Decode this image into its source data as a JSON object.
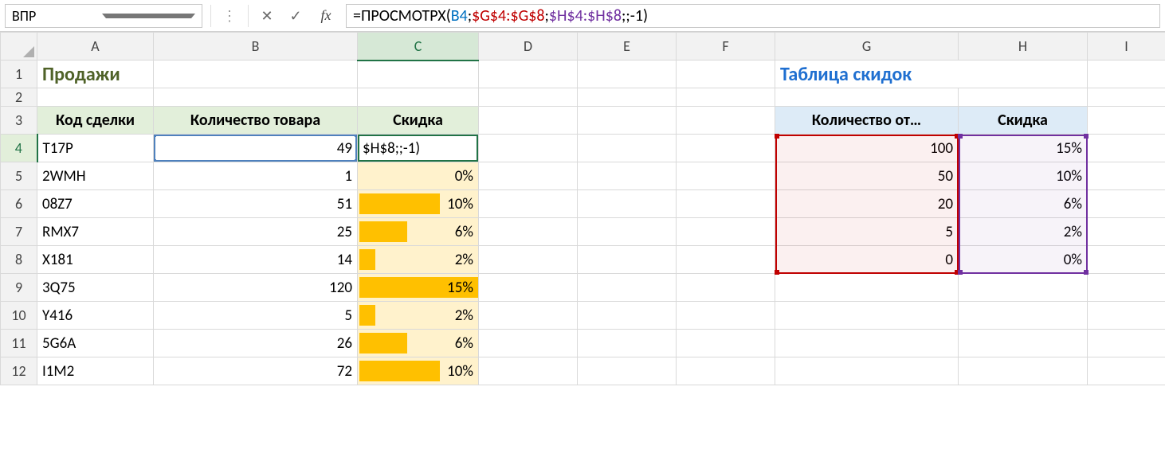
{
  "name_box": "ВПР",
  "fx_label": "fx",
  "formula": {
    "full": "=ПРОСМОТРХ(B4;$G$4:$G$8;$H$4:$H$8;;-1)",
    "parts": [
      {
        "t": "=",
        "cls": "eq"
      },
      {
        "t": "ПРОСМОТРХ",
        "cls": "fn"
      },
      {
        "t": "(",
        "cls": "plain"
      },
      {
        "t": "B4",
        "cls": "ref-blue"
      },
      {
        "t": ";",
        "cls": "plain"
      },
      {
        "t": "$G$4:$G$8",
        "cls": "ref-red"
      },
      {
        "t": ";",
        "cls": "plain"
      },
      {
        "t": "$H$4:$H$8",
        "cls": "ref-purple"
      },
      {
        "t": ";;-1)",
        "cls": "plain"
      }
    ]
  },
  "columns": [
    "A",
    "B",
    "C",
    "D",
    "E",
    "F",
    "G",
    "H",
    "I"
  ],
  "row_headers": [
    "1",
    "2",
    "3",
    "4",
    "5",
    "6",
    "7",
    "8",
    "9",
    "10",
    "11",
    "12"
  ],
  "titles": {
    "sales": "Продажи",
    "disc_table": "Таблица скидок"
  },
  "sales_headers": {
    "code": "Код сделки",
    "qty": "Количество товара",
    "discount": "Скидка"
  },
  "disc_headers": {
    "qty_from": "Количество от…",
    "discount": "Скидка"
  },
  "editing_cell_text": "$H$8;;-1)",
  "sales_rows": [
    {
      "code": "T17P",
      "qty": "49",
      "disc": "$H$8;;-1)",
      "bar": 0,
      "editing": true
    },
    {
      "code": "2WMH",
      "qty": "1",
      "disc": "0%",
      "bar": 0
    },
    {
      "code": "08Z7",
      "qty": "51",
      "disc": "10%",
      "bar": 67
    },
    {
      "code": "RMX7",
      "qty": "25",
      "disc": "6%",
      "bar": 40
    },
    {
      "code": "X181",
      "qty": "14",
      "disc": "2%",
      "bar": 13
    },
    {
      "code": "3Q75",
      "qty": "120",
      "disc": "15%",
      "bar": 100
    },
    {
      "code": "Y416",
      "qty": "5",
      "disc": "2%",
      "bar": 13
    },
    {
      "code": "5G6A",
      "qty": "26",
      "disc": "6%",
      "bar": 40
    },
    {
      "code": "I1M2",
      "qty": "72",
      "disc": "10%",
      "bar": 67
    }
  ],
  "disc_rows": [
    {
      "qty": "100",
      "disc": "15%"
    },
    {
      "qty": "50",
      "disc": "10%"
    },
    {
      "qty": "20",
      "disc": "6%"
    },
    {
      "qty": "5",
      "disc": "2%"
    },
    {
      "qty": "0",
      "disc": "0%"
    }
  ],
  "chart_data": {
    "type": "table",
    "tables": [
      {
        "name": "Продажи",
        "columns": [
          "Код сделки",
          "Количество товара",
          "Скидка"
        ],
        "rows": [
          [
            "T17P",
            49,
            null
          ],
          [
            "2WMH",
            1,
            "0%"
          ],
          [
            "08Z7",
            51,
            "10%"
          ],
          [
            "RMX7",
            25,
            "6%"
          ],
          [
            "X181",
            14,
            "2%"
          ],
          [
            "3Q75",
            120,
            "15%"
          ],
          [
            "Y416",
            5,
            "2%"
          ],
          [
            "5G6A",
            26,
            "6%"
          ],
          [
            "I1M2",
            72,
            "10%"
          ]
        ]
      },
      {
        "name": "Таблица скидок",
        "columns": [
          "Количество от…",
          "Скидка"
        ],
        "rows": [
          [
            100,
            "15%"
          ],
          [
            50,
            "10%"
          ],
          [
            20,
            "6%"
          ],
          [
            5,
            "2%"
          ],
          [
            0,
            "0%"
          ]
        ]
      }
    ]
  }
}
